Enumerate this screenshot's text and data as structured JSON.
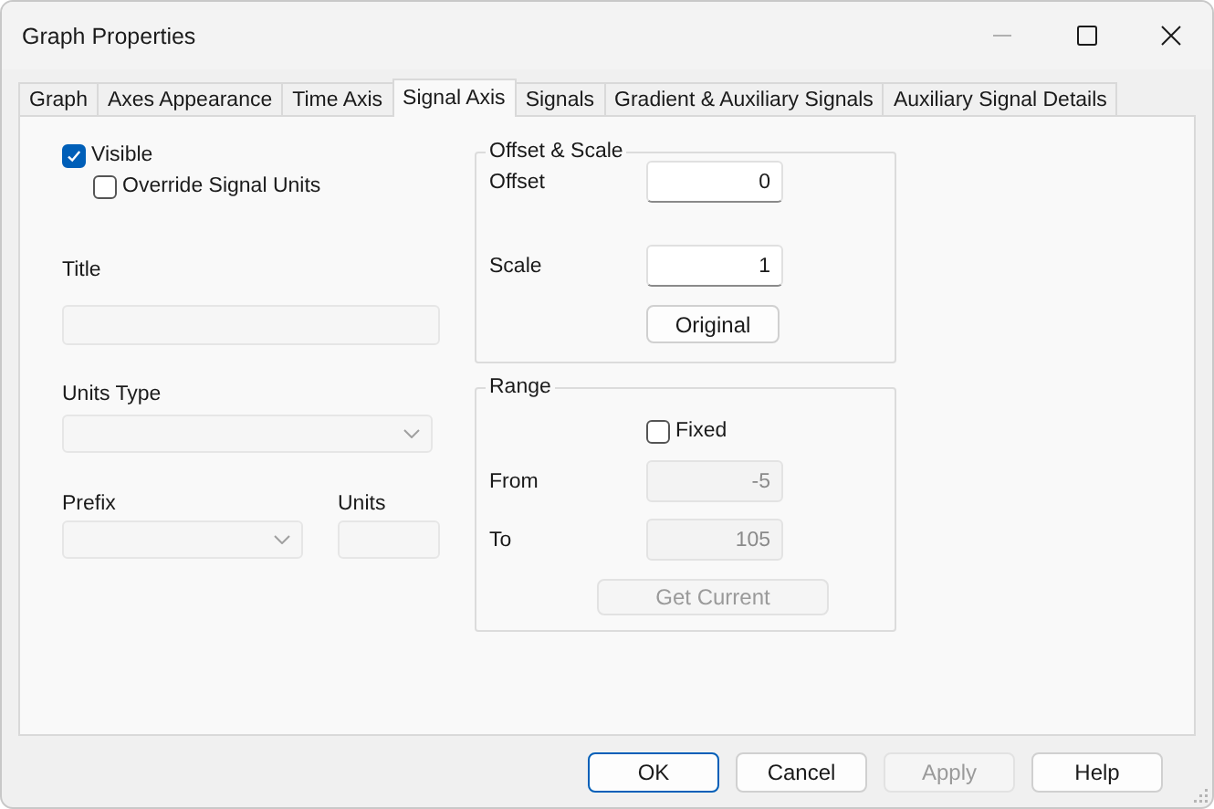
{
  "window": {
    "title": "Graph Properties"
  },
  "tabs": [
    {
      "label": "Graph",
      "selected": false
    },
    {
      "label": "Axes Appearance",
      "selected": false
    },
    {
      "label": "Time Axis",
      "selected": false
    },
    {
      "label": "Signal Axis",
      "selected": true
    },
    {
      "label": "Signals",
      "selected": false
    },
    {
      "label": "Gradient & Auxiliary Signals",
      "selected": false
    },
    {
      "label": "Auxiliary Signal Details",
      "selected": false
    }
  ],
  "visible": {
    "label": "Visible",
    "checked": true
  },
  "override_units": {
    "label": "Override Signal Units",
    "checked": false
  },
  "title_field": {
    "label": "Title",
    "disabled": true
  },
  "units_type": {
    "label": "Units Type",
    "disabled": true
  },
  "prefix": {
    "label": "Prefix",
    "disabled": true
  },
  "units": {
    "label": "Units",
    "disabled": true
  },
  "offset_scale": {
    "legend": "Offset & Scale",
    "offset": {
      "label": "Offset",
      "value": "0",
      "disabled": false
    },
    "scale": {
      "label": "Scale",
      "value": "1",
      "disabled": false
    },
    "original_button": {
      "label": "Original",
      "disabled": false
    }
  },
  "range": {
    "legend": "Range",
    "fixed": {
      "label": "Fixed",
      "checked": false
    },
    "from": {
      "label": "From",
      "value": "-5",
      "disabled": true
    },
    "to": {
      "label": "To",
      "value": "105",
      "disabled": true
    },
    "get_current": {
      "label": "Get Current",
      "disabled": true
    }
  },
  "buttons": [
    {
      "label": "OK",
      "default": true,
      "disabled": false
    },
    {
      "label": "Cancel",
      "default": false,
      "disabled": false
    },
    {
      "label": "Apply",
      "default": false,
      "disabled": true
    },
    {
      "label": "Help",
      "default": false,
      "disabled": false
    }
  ]
}
